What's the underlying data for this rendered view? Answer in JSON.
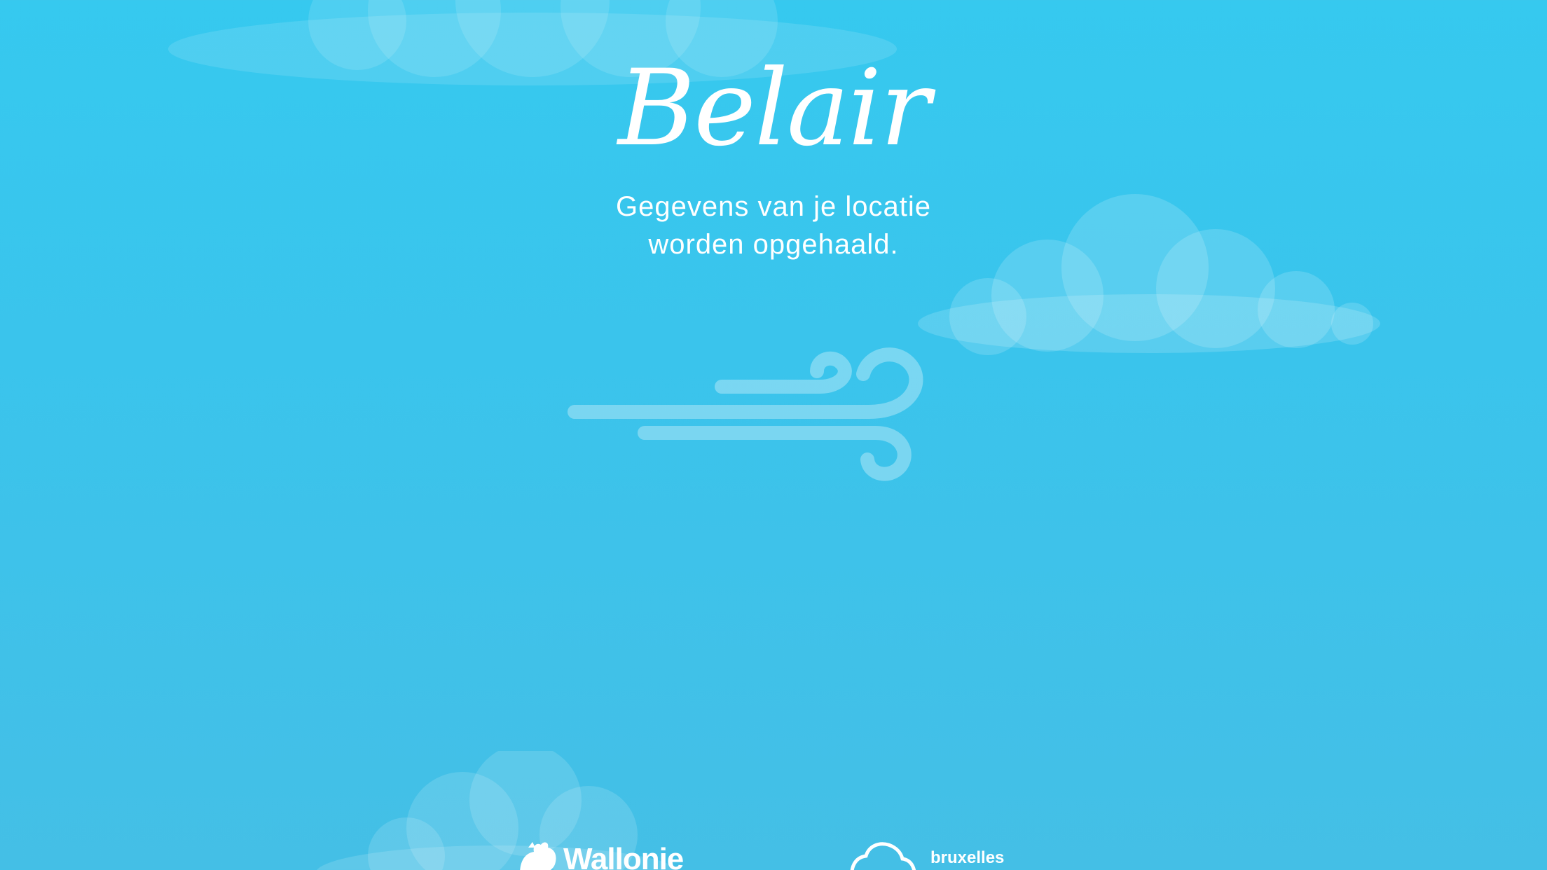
{
  "app": {
    "title": "Belair",
    "status_line_1": "Gegevens van je locatie",
    "status_line_2": "worden opgehaald."
  },
  "illustration": {
    "center_icon": "wind-icon",
    "decorations": [
      "cloud-icon",
      "cloud-icon",
      "cloud-icon"
    ]
  },
  "footer": {
    "logos": [
      {
        "name": "Wallonie",
        "icon": "rooster-icon"
      },
      {
        "name": "bruxelles",
        "icon": "cloud-logo-icon"
      }
    ]
  },
  "colors": {
    "background_top": "#36c9ef",
    "background_bottom": "#44bfe6",
    "text": "#ffffff"
  }
}
